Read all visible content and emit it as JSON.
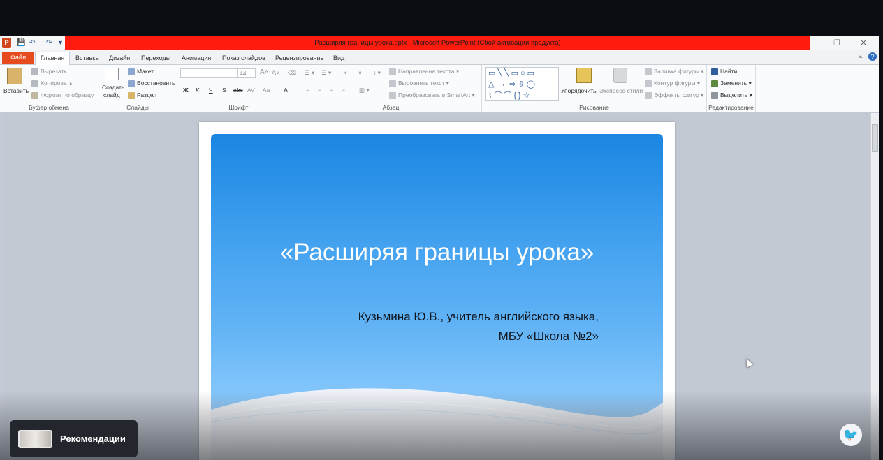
{
  "window": {
    "title": "Расширяя границы урока.pptx - Microsoft PowerPoint (Сбой активации продукта)",
    "app_icon_letter": "P",
    "qat": {
      "save": "💾",
      "undo": "↶",
      "redo": "↷",
      "customize": "▾"
    },
    "controls": {
      "minimize": "─",
      "restore": "❐",
      "close": "✕"
    }
  },
  "tabs": [
    {
      "label": "Файл"
    },
    {
      "label": "Главная"
    },
    {
      "label": "Вставка"
    },
    {
      "label": "Дизайн"
    },
    {
      "label": "Переходы"
    },
    {
      "label": "Анимация"
    },
    {
      "label": "Показ слайдов"
    },
    {
      "label": "Рецензирование"
    },
    {
      "label": "Вид"
    }
  ],
  "ribbon": {
    "clipboard": {
      "group_label": "Буфер обмена",
      "paste": "Вставить",
      "cut": "Вырезать",
      "copy": "Копировать",
      "format_painter": "Формат по образцу"
    },
    "slides": {
      "group_label": "Слайды",
      "new_slide_line1": "Создать",
      "new_slide_line2": "слайд",
      "layout": "Макет",
      "reset": "Восстановить",
      "section": "Раздел"
    },
    "font": {
      "group_label": "Шрифт",
      "font_name": "",
      "font_size": "44",
      "bold": "Ж",
      "italic": "К",
      "underline": "Ч",
      "strike": "S",
      "strikethrough": "abc",
      "spacing": "AV",
      "change_case": "Aa",
      "color": "A"
    },
    "paragraph": {
      "group_label": "Абзац",
      "text_direction": "Направление текста",
      "align_text": "Выровнять текст",
      "convert_smartart": "Преобразовать в SmartArt"
    },
    "drawing": {
      "group_label": "Рисование",
      "arrange": "Упорядочить",
      "quick_styles": "Экспресс-стили",
      "shape_fill": "Заливка фигуры",
      "shape_outline": "Контур фигуры",
      "shape_effects": "Эффекты фигур"
    },
    "editing": {
      "group_label": "Редактирование",
      "find": "Найти",
      "replace": "Заменить",
      "select": "Выделить"
    }
  },
  "slide": {
    "title": "«Расширяя границы урока»",
    "subtitle_line1": "Кузьмина Ю.В., учитель английского языка,",
    "subtitle_line2": "МБУ «Школа №2»"
  },
  "overlay": {
    "recommendations": "Рекомендации",
    "float_icon": "🐦"
  }
}
